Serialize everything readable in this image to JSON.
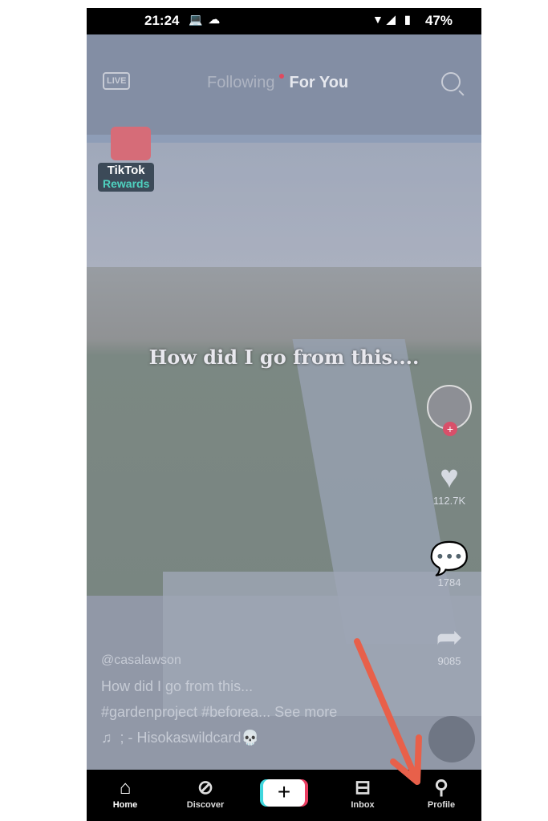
{
  "status_bar": {
    "time": "21:24",
    "battery": "47%",
    "icons": [
      "laptop-icon",
      "cloud-icon",
      "wifi-icon",
      "signal-icon",
      "battery-icon"
    ]
  },
  "top_bar": {
    "live": "LIVE",
    "tab_following": "Following",
    "tab_for_you": "For You"
  },
  "rewards_badge": {
    "line1": "TikTok",
    "line2": "Rewards"
  },
  "video_caption": "How did I go from this....",
  "side_actions": {
    "likes": "112.7K",
    "comments": "1784",
    "shares": "9085"
  },
  "post": {
    "username": "@casalawson",
    "description": "How did I go from this...",
    "hashtags": "#gardenproject #beforea...",
    "see_more": "See more",
    "sound": "; - Hisokaswildcard💀"
  },
  "bottom_nav": {
    "home": "Home",
    "discover": "Discover",
    "create": "+",
    "inbox": "Inbox",
    "profile": "Profile"
  },
  "annotation": {
    "arrow_color": "#e8604a"
  }
}
